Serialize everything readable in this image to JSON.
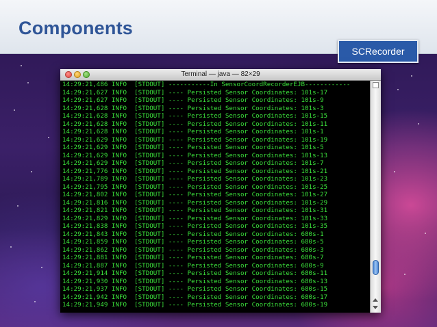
{
  "slide": {
    "title": "Components",
    "tag": "SCRecorder"
  },
  "terminal": {
    "window_title": "Terminal — java — 82×29",
    "lines": [
      "14:29:21,486 INFO  [STDOUT] -----------In SensorCoordRecorderEJB------------",
      "14:29:21,627 INFO  [STDOUT] ---- Persisted Sensor Coordinates: 101s-17",
      "14:29:21,627 INFO  [STDOUT] ---- Persisted Sensor Coordinates: 101s-9",
      "14:29:21,628 INFO  [STDOUT] ---- Persisted Sensor Coordinates: 101s-3",
      "14:29:21,628 INFO  [STDOUT] ---- Persisted Sensor Coordinates: 101s-15",
      "14:29:21,628 INFO  [STDOUT] ---- Persisted Sensor Coordinates: 101s-11",
      "14:29:21,628 INFO  [STDOUT] ---- Persisted Sensor Coordinates: 101s-1",
      "14:29:21,629 INFO  [STDOUT] ---- Persisted Sensor Coordinates: 101s-19",
      "14:29:21,629 INFO  [STDOUT] ---- Persisted Sensor Coordinates: 101s-5",
      "14:29:21,629 INFO  [STDOUT] ---- Persisted Sensor Coordinates: 101s-13",
      "14:29:21,629 INFO  [STDOUT] ---- Persisted Sensor Coordinates: 101s-7",
      "14:29:21,776 INFO  [STDOUT] ---- Persisted Sensor Coordinates: 101s-21",
      "14:29:21,789 INFO  [STDOUT] ---- Persisted Sensor Coordinates: 101s-23",
      "14:29:21,795 INFO  [STDOUT] ---- Persisted Sensor Coordinates: 101s-25",
      "14:29:21,802 INFO  [STDOUT] ---- Persisted Sensor Coordinates: 101s-27",
      "14:29:21,816 INFO  [STDOUT] ---- Persisted Sensor Coordinates: 101s-29",
      "14:29:21,821 INFO  [STDOUT] ---- Persisted Sensor Coordinates: 101s-31",
      "14:29:21,829 INFO  [STDOUT] ---- Persisted Sensor Coordinates: 101s-33",
      "14:29:21,838 INFO  [STDOUT] ---- Persisted Sensor Coordinates: 101s-35",
      "14:29:21,843 INFO  [STDOUT] ---- Persisted Sensor Coordinates: 680s-1",
      "14:29:21,859 INFO  [STDOUT] ---- Persisted Sensor Coordinates: 680s-5",
      "14:29:21,862 INFO  [STDOUT] ---- Persisted Sensor Coordinates: 680s-3",
      "14:29:21,881 INFO  [STDOUT] ---- Persisted Sensor Coordinates: 680s-7",
      "14:29:21,887 INFO  [STDOUT] ---- Persisted Sensor Coordinates: 680s-9",
      "14:29:21,914 INFO  [STDOUT] ---- Persisted Sensor Coordinates: 680s-11",
      "14:29:21,930 INFO  [STDOUT] ---- Persisted Sensor Coordinates: 680s-13",
      "14:29:21,937 INFO  [STDOUT] ---- Persisted Sensor Coordinates: 680s-15",
      "14:29:21,942 INFO  [STDOUT] ---- Persisted Sensor Coordinates: 680s-17",
      "14:29:21,949 INFO  [STDOUT] ---- Persisted Sensor Coordinates: 680s-19"
    ],
    "text_color": "#3be03b",
    "background_color": "#000000"
  },
  "colors": {
    "title": "#2f5597",
    "tag_background": "#2a5aa8"
  }
}
